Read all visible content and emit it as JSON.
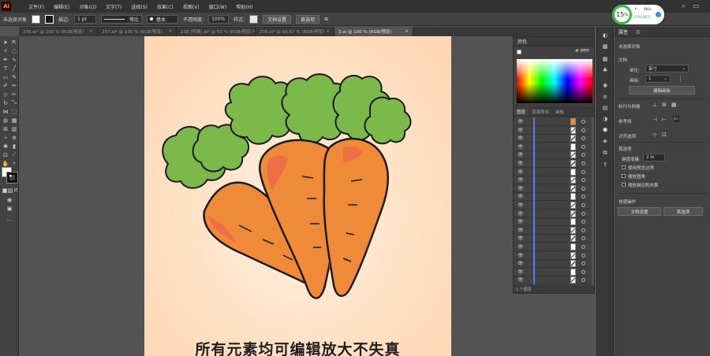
{
  "app": {
    "logo": "Ai"
  },
  "menu": [
    "文件(F)",
    "编辑(E)",
    "对象(O)",
    "文字(T)",
    "选择(S)",
    "效果(C)",
    "视图(V)",
    "窗口(W)",
    "帮助(H)"
  ],
  "menubar_right_icons": [
    "search-icon",
    "window-icon"
  ],
  "control_bar": {
    "no_selection": "未选择对象",
    "stroke_label": "描边:",
    "stroke_value": "1 pt",
    "line_label": "等比",
    "brush_label": "基本",
    "opacity_label": "不透明度:",
    "opacity_value": "100%",
    "style_label": "样式:",
    "doc_setup": "文档设置",
    "preferences": "首选项"
  },
  "tabs": [
    {
      "label": "236.ai* @ 200 % (RGB/预览)",
      "active": false
    },
    {
      "label": "237.ai* @ 100 % (RGB/预览)",
      "active": false
    },
    {
      "label": "238 [转换].ai* @ 50 % (RGB/预览)",
      "active": false
    },
    {
      "label": "239.ai* @ 66.67 % (RGB/预览)",
      "active": false
    },
    {
      "label": "3.ai @ 100 % (RGB/预览)",
      "active": true
    }
  ],
  "canvas": {
    "caption": "所有元素均可编辑放大不失真",
    "colors": {
      "carrot": "#ef8a38",
      "carrot_shade": "#ee6f45",
      "leaf": "#7ab94a",
      "outline": "#1b1b1b"
    }
  },
  "color_panel": {
    "title": "颜色",
    "hex_value": "ffffff"
  },
  "layers_panel": {
    "tabs": [
      "图层",
      "资源导出",
      "画板"
    ],
    "row_count": 20,
    "footer": "1 个图层"
  },
  "properties": {
    "tabs": [
      "属性",
      "库"
    ],
    "no_selection": "未选择对象",
    "document": "文档",
    "units_label": "单位:",
    "units_value": "英寸",
    "artboard_label": "画板:",
    "artboard_value": "1",
    "edit_artboards": "编辑画板",
    "rulers_grids": "标尺与网格",
    "guides": "参考线",
    "snap_options": "对齐选项",
    "preferences": "首选项",
    "keyboard_increment_label": "键盘增量:",
    "keyboard_increment_value": "2 in",
    "use_preview_bounds": "使用预览边界",
    "scale_corners": "缩放圆角",
    "scale_strokes": "缩放描边和效果",
    "quick_actions": "快速操作",
    "doc_setup_btn": "文档设置",
    "preferences_btn": "首选项"
  },
  "cpu_widget": {
    "percent": "15",
    "percent_sign": "%",
    "upload": "0K/s",
    "cpu_label": "CPU 40℃",
    "ring_color": "#2fbf4a"
  }
}
